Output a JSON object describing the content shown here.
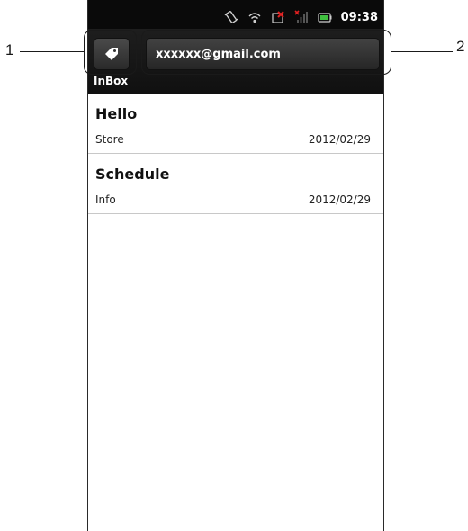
{
  "status_bar": {
    "time": "09:38",
    "icons": [
      "vibrate-icon",
      "wifi-icon",
      "no-sim-icon",
      "signal-off-icon",
      "battery-icon"
    ]
  },
  "app_bar": {
    "label_button_icon": "tag-icon",
    "account": "xxxxxx@gmail.com",
    "folder": "InBox"
  },
  "messages": [
    {
      "subject": "Hello",
      "sender": "Store",
      "date": "2012/02/29"
    },
    {
      "subject": "Schedule",
      "sender": "Info",
      "date": "2012/02/29"
    }
  ],
  "callouts": [
    {
      "number": "1"
    },
    {
      "number": "2"
    }
  ],
  "colors": {
    "bar": "#101010",
    "button": "#3a3a3a",
    "divider": "#c8c8c8",
    "battery": "#3fbf3f",
    "alert": "#e02020"
  }
}
